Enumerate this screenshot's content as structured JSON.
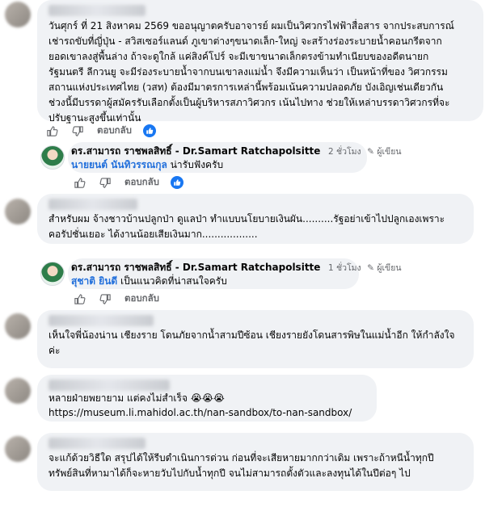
{
  "actions": {
    "reply_label": "ตอบกลับ"
  },
  "comments": [
    {
      "text": "วันศุกร์ ที่ 21 สิงหาคม 2569 ขออนุญาตครับอาจารย์ ผมเป็นวิศวกรไฟฟ้าสื่อสาร จากประสบการณ์\nเช่ารถขับที่ญี่ปุ่น - สวิสเซอร์แลนด์ ภูเขาต่างๆขนาดเล็ก-ใหญ่ จะสร้างร่องระบายน้ำคอนกรีตจาก\nยอดเขาลงสู่พื้นล่าง ถ้าจะดูใกล้ แค่สิงค์โปร์ จะมีเขาขนาดเล็กตรงข้ามทำเนียบของอดีตนายก\nรัฐมนตรี ลีกวนยู จะมีร่องระบายน้ำจากบนเขาลงแม่น้ำ จึงมีความเห็นว่า เป็นหน้าที่ของ วิศวกรรม\nสถานแห่งประเทศไทย (วสท) ต้องมีมาตรการเหล่านี้พร้อมเน้นความปลอดภัย บังเอิญเช่นเดียวกัน\nช่วงนี้มีบรรดาผู้สมัครรับเลือกตั้งเป็นผู้บริหารสภาวิศวกร เน้นไปทาง ช่วยให้เหล่าบรรดาวิศวกรที่จะ\nปรับฐานะสูงขึ้นเท่านั้น",
      "reply": {
        "author": "ดร.สามารถ ราชพลสิทธิ์ - Dr.Samart Ratchapolsitte",
        "time": "2 ชั่วโมง",
        "badge": "ผู้เขียน",
        "mention": "นายยนต์ นันทิวรรณกุล",
        "text": " น่ารับฟังครับ"
      }
    },
    {
      "text": "สำหรับผม จ้างชาวบ้านปลูกป่า ดูแลป่า ทำแบบนโยบายเงินผัน..........รัฐอย่าเข้าไปปลูกเองเพราะ\nคอรัปชั่นเยอะ ได้งานน้อยเสียเงินมาก..................",
      "reply": {
        "author": "ดร.สามารถ ราชพลสิทธิ์ - Dr.Samart Ratchapolsitte",
        "time": "1 ชั่วโมง",
        "badge": "ผู้เขียน",
        "mention": "สุชาติ ยินดี",
        "text": " เป็นแนวคิดที่น่าสนใจครับ"
      }
    },
    {
      "text": "เห็นใจพี่น้องน่าน เชียงราย โดนภัยจากน้ำสามปีซ้อน เชียงรายยังโดนสารพิษในแม่น้ำอีก ให้กำลังใจ\nค่ะ"
    },
    {
      "text": "หลายฝ่ายพยายาม แต่คงไม่สำเร็จ 😭😭😭",
      "link": "https://museum.li.mahidol.ac.th/nan-sandbox/to-nan-sandbox/"
    },
    {
      "text": "จะแก้ด้วยวิธีใด สรุปได้ให้รีบดำเนินการด่วน ก่อนที่จะเสียหายมากกว่าเดิม เพราะถ้าหนีน้ำทุกปี\nทรัพย์สินที่หามาได้ก็จะหายวับไปกับน้ำทุกปี จนไม่สามารถตั้งตัวและลงทุนได้ในปีต่อๆ ไป"
    }
  ]
}
